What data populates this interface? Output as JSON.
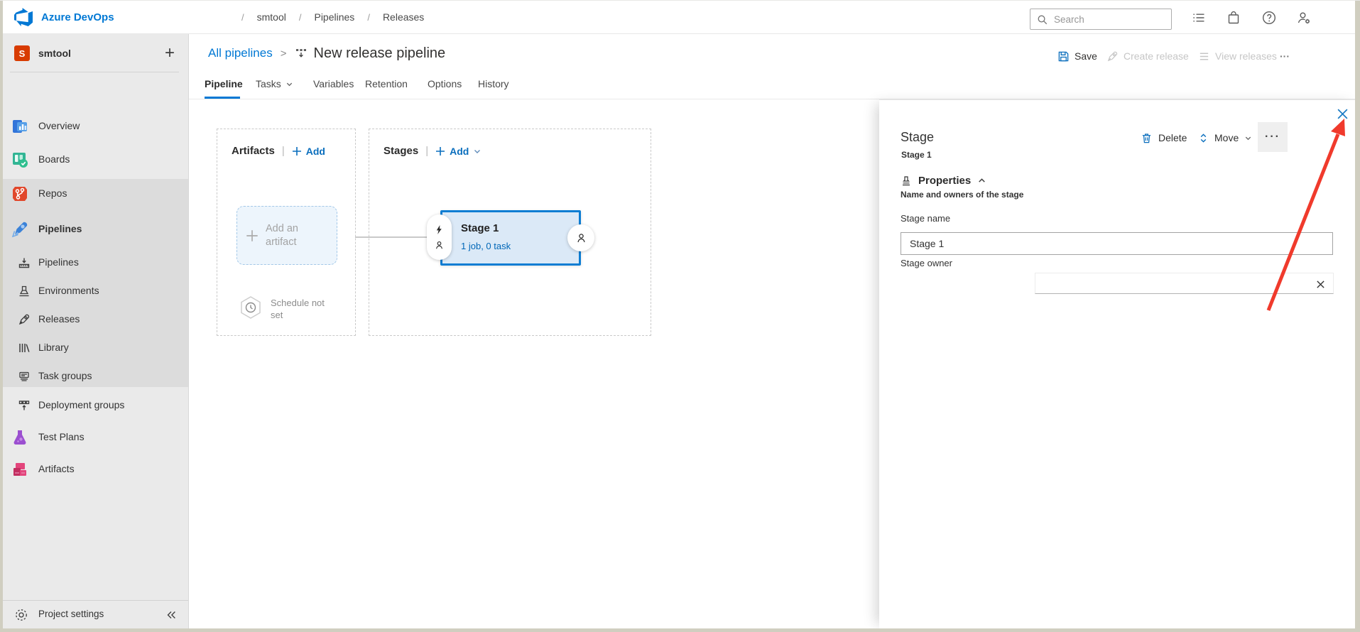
{
  "colors": {
    "accent": "#0078d4",
    "stage_border": "#0d7dd3",
    "stage_fill": "#dbe9f7",
    "arrow_red": "#f03a2c",
    "project_avatar": "#d83b01",
    "sidebar_bg": "#eaeaea",
    "sidebar_selected_bg": "#dcdcdc"
  },
  "topbar": {
    "brand": "Azure DevOps",
    "sep": "/",
    "breadcrumb": [
      "smtool",
      "Pipelines",
      "Releases"
    ],
    "search_placeholder": "Search"
  },
  "sidebar": {
    "project_name": "smtool",
    "project_avatar_letter": "S",
    "items": [
      {
        "label": "Overview"
      },
      {
        "label": "Boards"
      },
      {
        "label": "Repos"
      },
      {
        "label": "Pipelines"
      },
      {
        "label": "Pipelines"
      },
      {
        "label": "Environments"
      },
      {
        "label": "Releases"
      },
      {
        "label": "Library"
      },
      {
        "label": "Task groups"
      },
      {
        "label": "Deployment groups"
      },
      {
        "label": "Test Plans"
      },
      {
        "label": "Artifacts"
      }
    ],
    "footer_label": "Project settings"
  },
  "page": {
    "breadcrumb_link": "All pipelines",
    "sep": ">",
    "title": "New release pipeline",
    "tabs": [
      "Pipeline",
      "Tasks",
      "Variables",
      "Retention",
      "Options",
      "History"
    ],
    "actions": {
      "save": "Save",
      "create_release": "Create release",
      "view_releases": "View releases",
      "more": "···"
    }
  },
  "canvas": {
    "artifacts": {
      "title": "Artifacts",
      "divider": "|",
      "add_label": "Add",
      "tile_label": "Add an artifact",
      "schedule_label": "Schedule not set"
    },
    "stages": {
      "title": "Stages",
      "divider": "|",
      "add_label": "Add",
      "stage_name": "Stage 1",
      "stage_meta": "1 job, 0 task"
    }
  },
  "panel": {
    "title": "Stage",
    "subtitle": "Stage 1",
    "delete_label": "Delete",
    "move_label": "Move",
    "more": "···",
    "properties_title": "Properties",
    "properties_desc": "Name and owners of the stage",
    "stage_name_label": "Stage name",
    "stage_name_value": "Stage 1",
    "stage_owner_label": "Stage owner"
  }
}
